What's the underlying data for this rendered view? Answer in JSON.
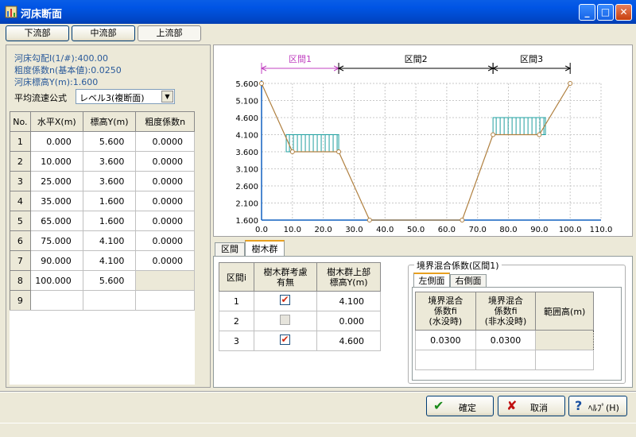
{
  "window": {
    "title": "河床断面"
  },
  "top_tabs": [
    "下流部",
    "中流部",
    "上流部"
  ],
  "info": {
    "slope": "河床勾配I(1/#):400.00",
    "roughness": "粗度係数n(基本値):0.0250",
    "elevation": "河床標高Y(m):1.600",
    "formula_label": "平均流速公式",
    "formula_value": "レベル3(複断面)"
  },
  "coord_table": {
    "headers": [
      "No.",
      "水平X(m)",
      "標高Y(m)",
      "粗度係数n"
    ],
    "rows": [
      [
        "1",
        "0.000",
        "5.600",
        "0.0000"
      ],
      [
        "2",
        "10.000",
        "3.600",
        "0.0000"
      ],
      [
        "3",
        "25.000",
        "3.600",
        "0.0000"
      ],
      [
        "4",
        "35.000",
        "1.600",
        "0.0000"
      ],
      [
        "5",
        "65.000",
        "1.600",
        "0.0000"
      ],
      [
        "6",
        "75.000",
        "4.100",
        "0.0000"
      ],
      [
        "7",
        "90.000",
        "4.100",
        "0.0000"
      ],
      [
        "8",
        "100.000",
        "5.600",
        ""
      ],
      [
        "9",
        "",
        "",
        ""
      ]
    ]
  },
  "chart_data": {
    "type": "line",
    "x": [
      0,
      10,
      25,
      35,
      65,
      75,
      90,
      100
    ],
    "y": [
      5.6,
      3.6,
      3.6,
      1.6,
      1.6,
      4.1,
      4.1,
      5.6
    ],
    "xlim": [
      0,
      110
    ],
    "ylim": [
      1.6,
      5.6
    ],
    "x_ticks": [
      "0.0",
      "10.0",
      "20.0",
      "30.0",
      "40.0",
      "50.0",
      "60.0",
      "70.0",
      "80.0",
      "90.0",
      "100.0",
      "110.0"
    ],
    "y_ticks": [
      "5.600",
      "5.100",
      "4.600",
      "4.100",
      "3.600",
      "3.100",
      "2.600",
      "2.100",
      "1.600"
    ],
    "sections": [
      {
        "label": "区間1",
        "from": 0,
        "to": 25,
        "color": "#c040c0"
      },
      {
        "label": "区間2",
        "from": 25,
        "to": 75,
        "color": "#000000"
      },
      {
        "label": "区間3",
        "from": 75,
        "to": 100,
        "color": "#000000"
      }
    ],
    "tree_groups": [
      {
        "x_from": 8,
        "x_to": 25,
        "y_from": 3.6,
        "y_to": 4.1
      },
      {
        "x_from": 75,
        "x_to": 92,
        "y_from": 4.1,
        "y_to": 4.6
      }
    ],
    "colors": {
      "line": "#b08040",
      "axis": "#1060c0",
      "grid": "#c8c8c8",
      "tree": "#20a0a0"
    }
  },
  "lower_tabs": [
    "区間",
    "樹木群"
  ],
  "tree_table": {
    "headers": [
      "区間i",
      "樹木群考慮\n有無",
      "樹木群上部\n標高Y(m)"
    ],
    "rows": [
      {
        "i": "1",
        "checked": true,
        "height": "4.100"
      },
      {
        "i": "2",
        "checked": false,
        "height": "0.000"
      },
      {
        "i": "3",
        "checked": true,
        "height": "4.600"
      }
    ]
  },
  "boundary": {
    "group_label": "境界混合係数(区間1)",
    "tabs": [
      "左側面",
      "右側面"
    ],
    "headers": [
      "境界混合\n係数fi\n(水没時)",
      "境界混合\n係数fi\n(非水没時)",
      "範囲高(m)"
    ],
    "row": [
      "0.0300",
      "0.0300",
      ""
    ]
  },
  "buttons": {
    "ok": "確定",
    "cancel": "取消",
    "help": "ﾍﾙﾌﾟ(H)"
  }
}
